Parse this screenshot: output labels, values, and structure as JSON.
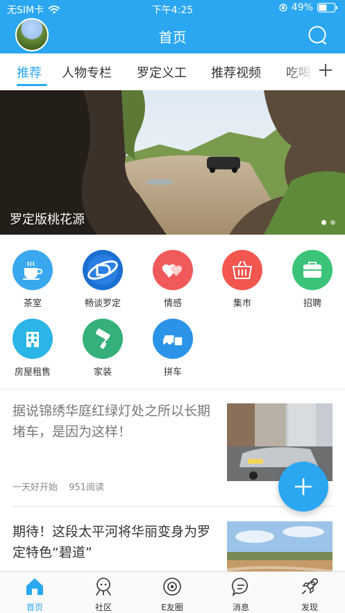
{
  "status_bar": {
    "carrier": "无SIM卡",
    "time": "下午4:25",
    "battery": "49%"
  },
  "header": {
    "title": "首页"
  },
  "tabs": [
    {
      "label": "推荐",
      "active": true
    },
    {
      "label": "人物专栏",
      "active": false
    },
    {
      "label": "罗定义工",
      "active": false
    },
    {
      "label": "推荐视频",
      "active": false
    },
    {
      "label": "吃喝",
      "active": false
    }
  ],
  "banner": {
    "caption": "罗定版桃花源",
    "current_slide": 1,
    "slide_count": 2
  },
  "categories": [
    {
      "label": "茶室",
      "icon": "tea-cup-icon",
      "color": "#3aa8ee"
    },
    {
      "label": "畅谈罗定",
      "icon": "chat-logo-icon",
      "color": "#1a6fd0"
    },
    {
      "label": "情感",
      "icon": "hearts-icon",
      "color": "#f05a5a"
    },
    {
      "label": "集市",
      "icon": "basket-icon",
      "color": "#f2564e"
    },
    {
      "label": "招聘",
      "icon": "briefcase-icon",
      "color": "#3cc37a"
    },
    {
      "label": "房屋租售",
      "icon": "building-icon",
      "color": "#2ab5e6"
    },
    {
      "label": "家装",
      "icon": "paint-roller-icon",
      "color": "#35b07a"
    },
    {
      "label": "拼车",
      "icon": "carpool-icon",
      "color": "#2b93e8"
    }
  ],
  "articles": [
    {
      "title": "据说锦绣华庭红绿灯处之所以长期堵车，是因为这样！",
      "author": "一天好开始",
      "reads": "951阅读",
      "read": true
    },
    {
      "title": "期待！这段太平河将华丽变身为罗定特色“碧道”",
      "read": false
    }
  ],
  "bottom_nav": [
    {
      "label": "首页",
      "icon": "home-icon",
      "active": true
    },
    {
      "label": "社区",
      "icon": "community-icon",
      "active": false
    },
    {
      "label": "E友圈",
      "icon": "camera-circle-icon",
      "active": false
    },
    {
      "label": "消息",
      "icon": "message-icon",
      "active": false
    },
    {
      "label": "发现",
      "icon": "rocket-icon",
      "active": false
    }
  ],
  "colors": {
    "accent": "#2aa7f0",
    "text": "#333333",
    "muted": "#888888"
  }
}
